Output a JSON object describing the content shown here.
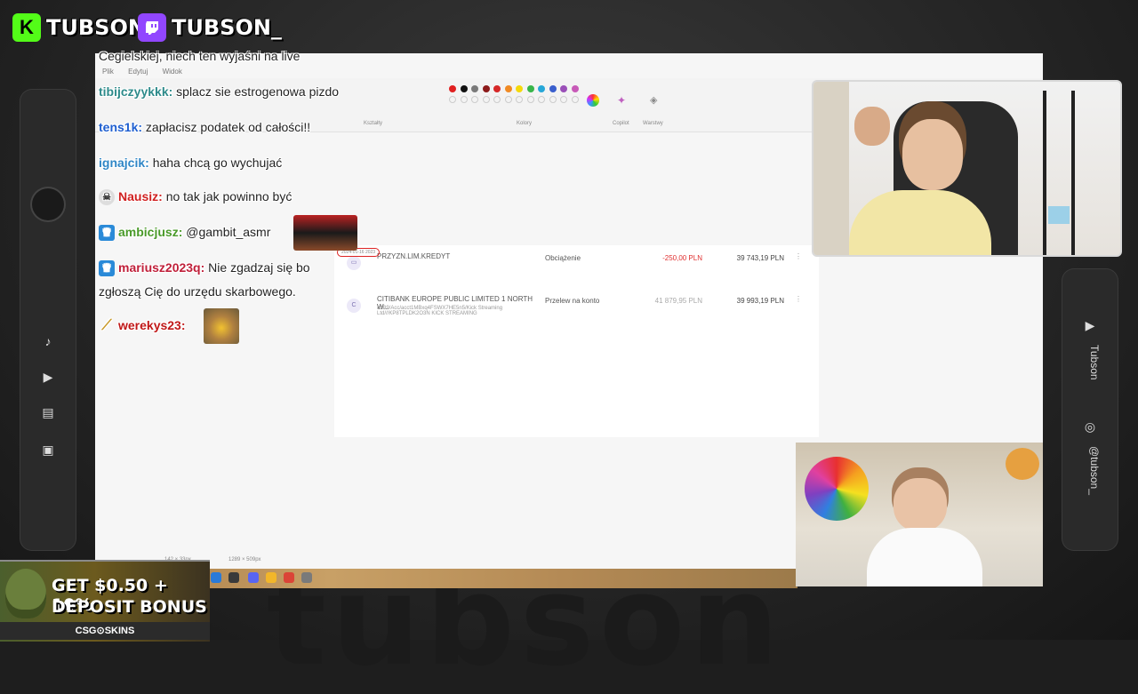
{
  "brands": {
    "kick": {
      "letter": "K",
      "name": "TUBSON",
      "color": "#53fc18"
    },
    "twitch": {
      "name": "TUBSON_",
      "color": "#9146ff"
    }
  },
  "background_word": "tubson",
  "left_panel": {
    "icons": [
      "music-icon",
      "play-icon",
      "clapper-icon",
      "image-icon"
    ]
  },
  "right_panel": {
    "youtube_label": "Tubson",
    "instagram_label": "@tubson_"
  },
  "paint": {
    "menu": [
      "Plik",
      "Edytuj",
      "Widok"
    ],
    "groups": [
      "Kształty",
      "Kolory",
      "Copilot",
      "Warstwy"
    ],
    "palette_row1": [
      "#e02020",
      "#111111",
      "#7a7a7a",
      "#8c1a1a",
      "#d62828",
      "#f08a24",
      "#f5d90a",
      "#38b54a",
      "#27a7d8",
      "#3a5fcd",
      "#9a4fb8",
      "#c85ab8"
    ],
    "statusbar": [
      "142 × 33px",
      "1289 × 509px"
    ]
  },
  "bank": {
    "date": "2024-01-16 2023",
    "rows": [
      {
        "name": "PRZYZN.LIM.KREDYT",
        "sub": "",
        "type": "Obciążenie",
        "amount": "-250,00 PLN",
        "balance": "39 743,19 PLN",
        "amount_color": "#e03030"
      },
      {
        "name": "CITIBANK EUROPE PUBLIC LIMITED 1 NORTH W...",
        "sub": "/OB9/Acc/acct1MBxq4FSWX7HE5n5/Kick Streaming Ltd///KP8TPLDK2O3N KICK STREAMING",
        "type": "Przelew na konto",
        "amount": "41 879,95 PLN",
        "balance": "39 993,19 PLN",
        "amount_color": "#aaaaaa"
      }
    ]
  },
  "chat": [
    {
      "user": "",
      "text": "Cegielskiej, niech ten wyjaśni na live",
      "color": "#222222",
      "badge": ""
    },
    {
      "user": "tibijczyykkk:",
      "text": "splacz sie estrogenowa pizdo",
      "color": "#2e8b8b",
      "badge": ""
    },
    {
      "user": "tens1k:",
      "text": "zapłacisz podatek od całości!!",
      "color": "#1f5fd0",
      "badge": ""
    },
    {
      "user": "ignajcik:",
      "text": "haha chcą go wychujać",
      "color": "#2f86c6",
      "badge": ""
    },
    {
      "user": "Nausiz:",
      "text": "no tak jak powinno być",
      "color": "#d02020",
      "badge": "skull"
    },
    {
      "user": "ambicjusz:",
      "text": "@gambit_asmr",
      "color": "#4a9a2a",
      "badge": "crown"
    },
    {
      "user": "mariusz2023q:",
      "text": "Nie zgadzaj się bo",
      "color": "#c0203a",
      "badge": "crown"
    },
    {
      "user": "",
      "text": "zgłoszą Cię do urzędu skarbowego.",
      "color": "#222222",
      "badge": ""
    },
    {
      "user": "werekys23:",
      "text": "",
      "color": "#c01818",
      "badge": "banana"
    }
  ],
  "ad": {
    "line1": "GET $0.50 + 10%",
    "line2": "DEPOSIT BONUS",
    "brand": "CSG⊙SKINS"
  }
}
